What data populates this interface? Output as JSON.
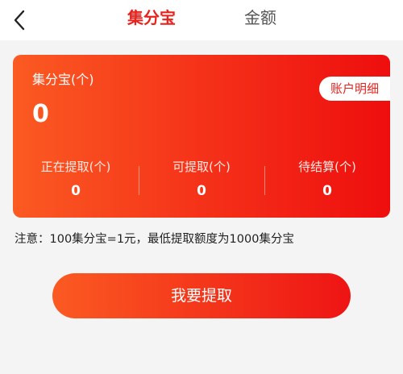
{
  "header": {
    "tabs": [
      {
        "label": "集分宝",
        "active": true
      },
      {
        "label": "金额",
        "active": false
      }
    ]
  },
  "card": {
    "title": "集分宝(个)",
    "total": "0",
    "ledger_button": "账户明细",
    "stats": [
      {
        "label": "正在提取(个)",
        "value": "0"
      },
      {
        "label": "可提取(个)",
        "value": "0"
      },
      {
        "label": "待结算(个)",
        "value": "0"
      }
    ]
  },
  "notice": "注意：100集分宝=1元，最低提取额度为1000集分宝",
  "action": {
    "withdraw_label": "我要提取"
  },
  "colors": {
    "accent": "#e8231d",
    "gradient_start": "#fb5a22",
    "gradient_end": "#ee0e0e"
  },
  "icons": {
    "back": "chevron-left-icon"
  }
}
